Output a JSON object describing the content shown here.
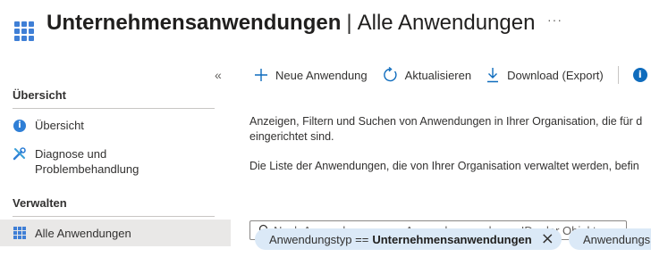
{
  "header": {
    "title_bold": "Unternehmensanwendungen",
    "separator": "|",
    "title_rest": "Alle Anwendungen",
    "more_label": "···",
    "app_icon": "enterprise-apps-grid-icon"
  },
  "sidebar": {
    "collapse_label": "«",
    "sections": [
      {
        "label": "Übersicht"
      },
      {
        "label": "Verwalten"
      }
    ],
    "items": [
      {
        "label": "Übersicht",
        "icon": "info-icon"
      },
      {
        "label": "Diagnose und Problembehandlung",
        "icon": "wrench-icon"
      },
      {
        "label": "Alle Anwendungen",
        "icon": "grid-icon",
        "active": true
      }
    ]
  },
  "toolbar": {
    "new_app": "Neue Anwendung",
    "refresh": "Aktualisieren",
    "download": "Download (Export)",
    "info_icon": "info-icon"
  },
  "main": {
    "description_1a": "Anzeigen, Filtern und Suchen von Anwendungen in Ihrer Organisation, die für d",
    "description_1b": "eingerichtet sind.",
    "description_2": "Die Liste der Anwendungen, die von Ihrer Organisation verwaltet werden, befin",
    "search_placeholder": "Nach Anwendungsname, Anwendungsvorlagen-ID oder Objekt...",
    "filters": [
      {
        "label": "Anwendungstyp ==",
        "value": "Unternehmensanwendungen",
        "remove": "×"
      },
      {
        "label": "Anwendungs"
      }
    ]
  },
  "colors": {
    "accent": "#0f6cbd",
    "pill_bg": "#dbe9f7",
    "active_nav_bg": "#e9e8e7"
  }
}
